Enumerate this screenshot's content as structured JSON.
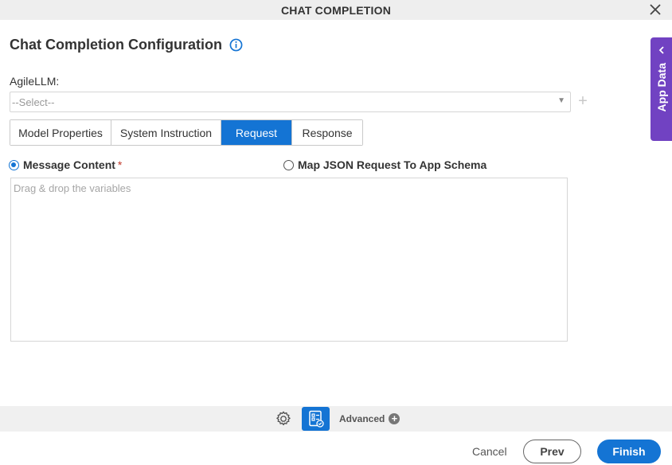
{
  "window": {
    "title": "CHAT COMPLETION",
    "close_icon": "close-icon"
  },
  "heading": {
    "title": "Chat Completion Configuration",
    "info_icon": "info-icon"
  },
  "llm": {
    "label": "AgileLLM:",
    "selected": "--Select--"
  },
  "tabs": [
    {
      "label": "Model Properties",
      "active": false
    },
    {
      "label": "System Instruction",
      "active": false
    },
    {
      "label": "Request",
      "active": true
    },
    {
      "label": "Response",
      "active": false
    }
  ],
  "request": {
    "option_message": "Message Content",
    "required_mark": "*",
    "option_map": "Map JSON Request To App Schema",
    "placeholder": "Drag & drop the variables"
  },
  "side_panel": {
    "label": "App Data"
  },
  "toolbar": {
    "advanced_label": "Advanced"
  },
  "footer": {
    "cancel": "Cancel",
    "prev": "Prev",
    "finish": "Finish"
  },
  "colors": {
    "accent": "#1474d4",
    "side_panel": "#7142c2",
    "required": "#c0392b"
  }
}
